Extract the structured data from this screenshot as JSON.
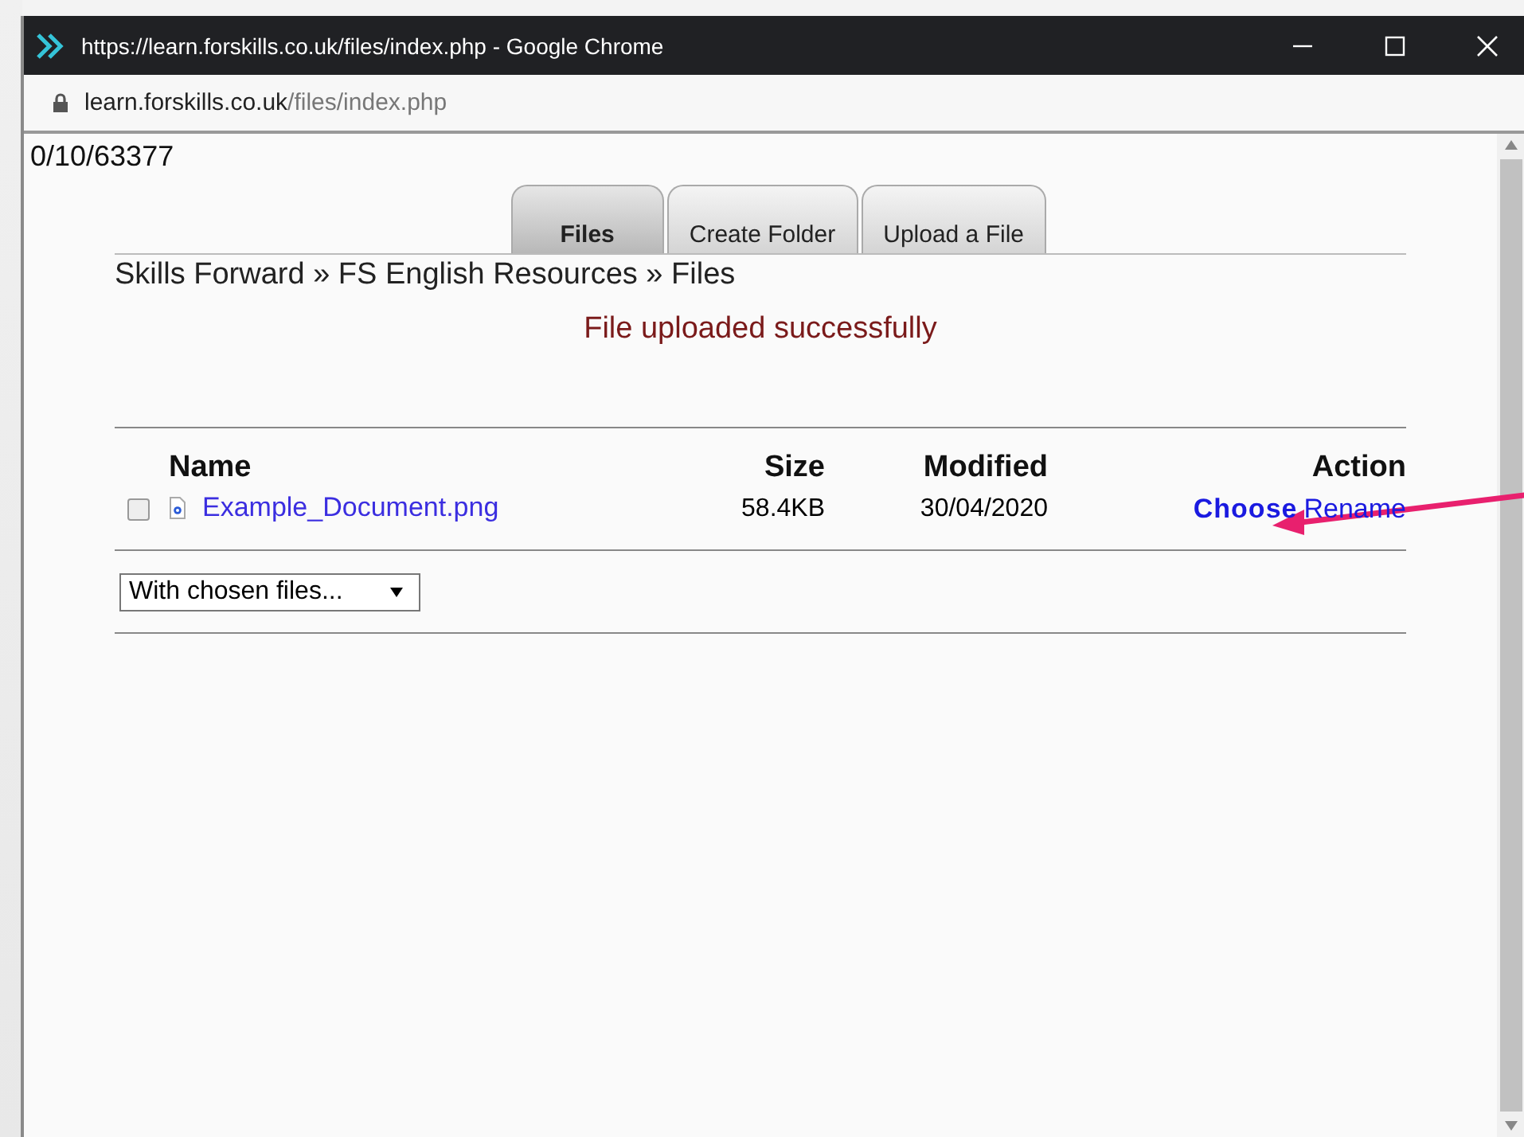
{
  "window": {
    "title": "https://learn.forskills.co.uk/files/index.php - Google Chrome"
  },
  "address": {
    "host": "learn.forskills.co.uk",
    "path": "/files/index.php"
  },
  "page_id": "0/10/63377",
  "tabs": [
    {
      "label": "Files",
      "selected": true
    },
    {
      "label": "Create Folder",
      "selected": false
    },
    {
      "label": "Upload a File",
      "selected": false
    }
  ],
  "breadcrumb": "Skills Forward » FS English Resources » Files",
  "message": "File uploaded successfully",
  "table": {
    "columns": [
      "Name",
      "Size",
      "Modified",
      "Action"
    ],
    "rows": [
      {
        "checked": false,
        "name": "Example_Document.png",
        "size": "58.4KB",
        "modified": "30/04/2020",
        "actions": [
          {
            "label": "Choose",
            "kind": "strong"
          },
          {
            "label": "Rename",
            "kind": "plain"
          }
        ]
      }
    ]
  },
  "bulk_select": {
    "value": "With chosen files..."
  }
}
